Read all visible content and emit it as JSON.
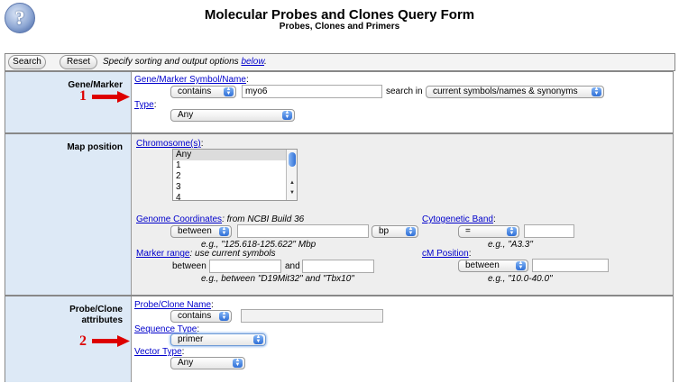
{
  "page": {
    "help_glyph": "?",
    "title": "Molecular Probes and Clones Query Form",
    "subtitle": "Probes, Clones and Primers"
  },
  "toolbar": {
    "search_label": "Search",
    "reset_label": "Reset",
    "spec_text": "Specify sorting and output options",
    "spec_link": "below",
    "spec_end": "."
  },
  "gene_marker": {
    "section_label": "Gene/Marker",
    "annotation_number": "1",
    "symbol_label": "Gene/Marker Symbol/Name",
    "symbol_colon": ":",
    "operator": "contains",
    "symbol_value": "myo6",
    "search_in_label": "search in",
    "search_in_value": "current symbols/names & synonyms",
    "type_label": "Type",
    "type_colon": ":",
    "type_value": "Any"
  },
  "map_position": {
    "section_label": "Map position",
    "chromosome_label": "Chromosome(s)",
    "chromosome_colon": ":",
    "chromosome_options": [
      "Any",
      "1",
      "2",
      "3",
      "4"
    ],
    "genome_coords_label": "Genome Coordinates",
    "genome_coords_note": ": from NCBI Build 36",
    "coord_operator": "between",
    "coord_unit": "bp",
    "coord_example": "e.g., \"125.618-125.622\" Mbp",
    "cyto_label": "Cytogenetic Band",
    "cyto_colon": ":",
    "cyto_operator": "=",
    "cyto_example": "e.g., \"A3.3\"",
    "marker_range_label": "Marker range",
    "marker_range_note": ": use current symbols",
    "between_word": "between",
    "and_word": "and",
    "marker_example": "e.g., between \"D19Mit32\" and \"Tbx10\"",
    "cm_label": "cM Position",
    "cm_colon": ":",
    "cm_operator": "between",
    "cm_example": "e.g., \"10.0-40.0\""
  },
  "probe_clone": {
    "section_label_line1": "Probe/Clone",
    "section_label_line2": "attributes",
    "annotation_number": "2",
    "name_label": "Probe/Clone Name",
    "name_colon": ":",
    "name_operator": "contains",
    "sequence_type_label": "Sequence Type",
    "sequence_type_colon": ":",
    "sequence_type_value": "primer",
    "vector_type_label": "Vector Type",
    "vector_type_colon": ":",
    "vector_type_value": "Any"
  },
  "colors": {
    "label_bg": "#dde9f6",
    "body_bg_gray": "#eeeeee",
    "link": "#0000cc",
    "annotation_red": "#dd0000"
  }
}
